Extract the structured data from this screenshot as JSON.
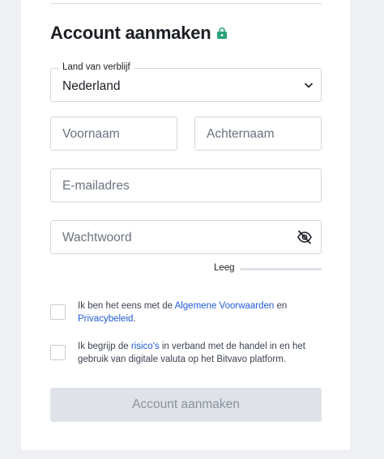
{
  "form": {
    "title": "Account aanmaken",
    "country": {
      "label": "Land van verblijf",
      "value": "Nederland"
    },
    "first_name_placeholder": "Voornaam",
    "last_name_placeholder": "Achternaam",
    "email_placeholder": "E-mailadres",
    "password_placeholder": "Wachtwoord",
    "password_strength_label": "Leeg",
    "password_strength_level": 0,
    "terms": {
      "prefix": "Ik ben het eens met de ",
      "terms_link": "Algemene Voorwaarden",
      "middle": " en ",
      "privacy_link": "Privacybeleid",
      "suffix": "."
    },
    "risk": {
      "prefix": "Ik begrijp de ",
      "risk_link": "risico's",
      "suffix": " in verband met de handel in en het gebruik van digitale valuta op het Bitvavo platform."
    },
    "submit_label": "Account aanmaken"
  },
  "colors": {
    "accent_lock": "#2aa37a",
    "link": "#1f5bd6",
    "button_disabled_bg": "#dfe3e9",
    "button_disabled_text": "#8a919c"
  },
  "icons": {
    "title_icon": "lock-icon",
    "select_icon": "chevron-down-icon",
    "password_icon": "eye-off-icon"
  }
}
